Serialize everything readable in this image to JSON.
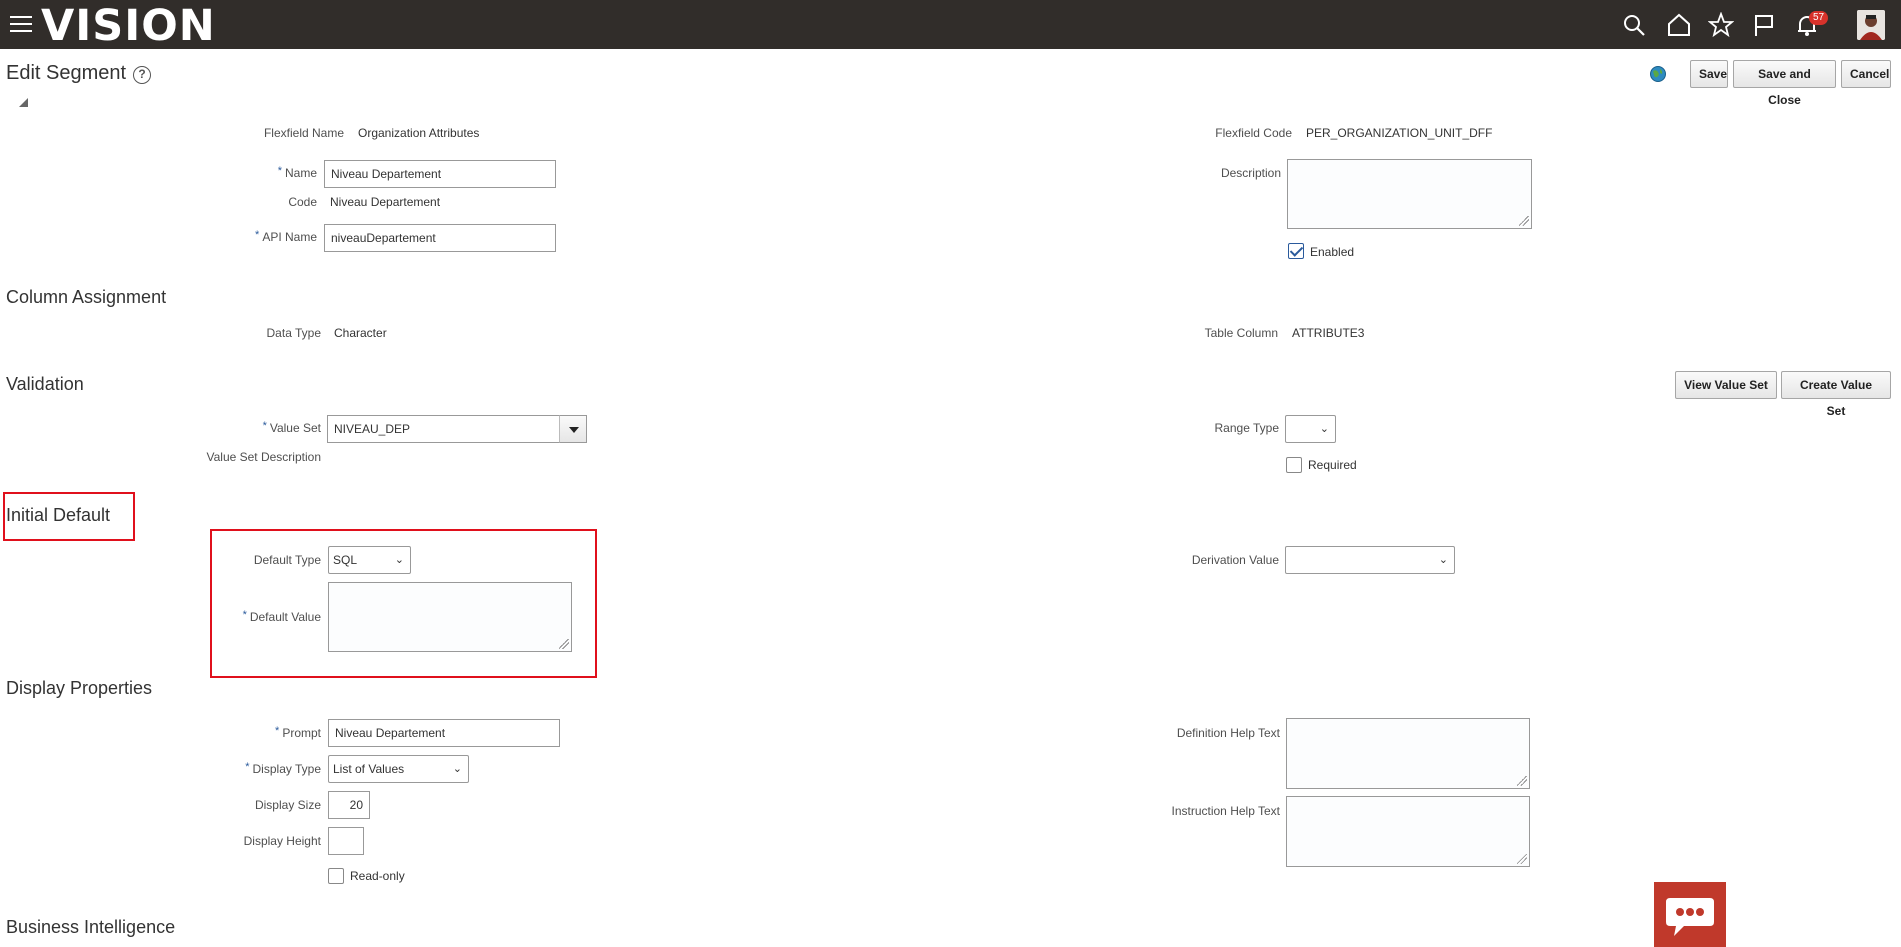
{
  "header": {
    "logo": "VISION",
    "notifications_count": "57"
  },
  "page": {
    "title": "Edit Segment",
    "help": "?",
    "buttons": {
      "save": "Save",
      "save_close": "Save and Close",
      "cancel": "Cancel"
    }
  },
  "segment": {
    "flexfield_name_label": "Flexfield Name",
    "flexfield_name": "Organization Attributes",
    "flexfield_code_label": "Flexfield Code",
    "flexfield_code": "PER_ORGANIZATION_UNIT_DFF",
    "name_label": "Name",
    "name": "Niveau Departement",
    "code_label": "Code",
    "code": "Niveau Departement",
    "api_name_label": "API Name",
    "api_name": "niveauDepartement",
    "description_label": "Description",
    "description": "",
    "enabled_label": "Enabled",
    "enabled": true
  },
  "column_assignment": {
    "title": "Column Assignment",
    "data_type_label": "Data Type",
    "data_type": "Character",
    "table_column_label": "Table Column",
    "table_column": "ATTRIBUTE3"
  },
  "validation": {
    "title": "Validation",
    "view_value_set": "View Value Set",
    "create_value_set": "Create Value Set",
    "value_set_label": "Value Set",
    "value_set": "NIVEAU_DEP",
    "value_set_description_label": "Value Set Description",
    "range_type_label": "Range Type",
    "range_type": "",
    "required_label": "Required",
    "required": false
  },
  "initial_default": {
    "title": "Initial Default",
    "default_type_label": "Default Type",
    "default_type": "SQL",
    "default_value_label": "Default Value",
    "default_value": "",
    "derivation_value_label": "Derivation Value",
    "derivation_value": ""
  },
  "display_properties": {
    "title": "Display Properties",
    "prompt_label": "Prompt",
    "prompt": "Niveau Departement",
    "display_type_label": "Display Type",
    "display_type": "List of Values",
    "display_size_label": "Display Size",
    "display_size": "20",
    "display_height_label": "Display Height",
    "display_height": "",
    "read_only_label": "Read-only",
    "read_only": false,
    "definition_help_label": "Definition Help Text",
    "instruction_help_label": "Instruction Help Text"
  },
  "business_intelligence": {
    "title": "Business Intelligence"
  },
  "colors": {
    "header_bg": "#312d2a",
    "highlight": "#e0101c",
    "required_star": "#2a5a9c",
    "chat_bg": "#c0392b"
  }
}
